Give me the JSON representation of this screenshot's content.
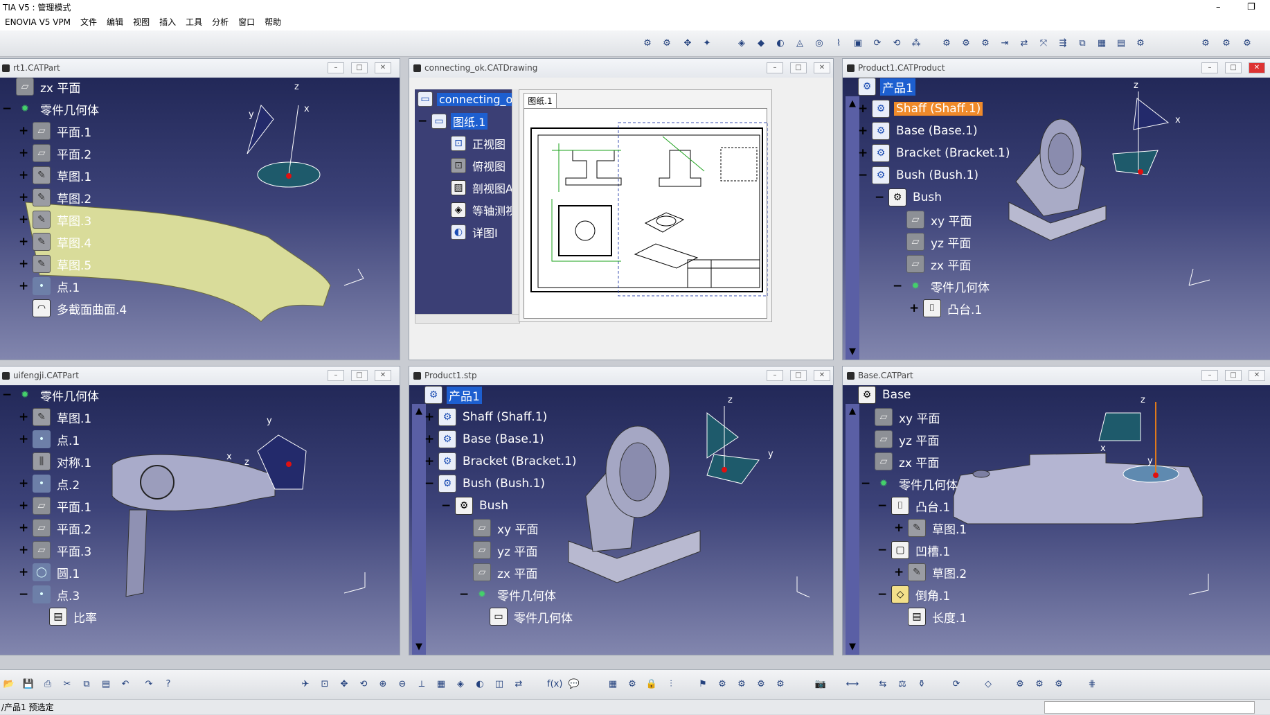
{
  "app": {
    "title": "TIA V5 : 管理模式",
    "status": "/产品1 预选定"
  },
  "menu": [
    "ENOVIA V5 VPM",
    "文件",
    "编辑",
    "视图",
    "插入",
    "工具",
    "分析",
    "窗口",
    "帮助"
  ],
  "windows": {
    "w1": {
      "title": "rt1.CATPart",
      "nodes": [
        "zx 平面",
        "零件几何体",
        "平面.1",
        "平面.2",
        "草图.1",
        "草图.2",
        "草图.3",
        "草图.4",
        "草图.5",
        "点.1",
        "多截面曲面.4"
      ]
    },
    "w2": {
      "title": "connecting_ok.CATDrawing",
      "tree": [
        "connecting_ok",
        "图纸.1",
        "正视图",
        "俯视图",
        "剖视图A",
        "等轴测视",
        "详图I"
      ],
      "tab": "图纸.1"
    },
    "w3": {
      "title": "Product1.CATProduct",
      "nodes": [
        "产品1",
        "Shaff (Shaff.1)",
        "Base (Base.1)",
        "Bracket (Bracket.1)",
        "Bush (Bush.1)",
        "Bush",
        "xy 平面",
        "yz 平面",
        "zx 平面",
        "零件几何体",
        "凸台.1"
      ]
    },
    "w4": {
      "title": "uifengji.CATPart",
      "nodes": [
        "零件几何体",
        "草图.1",
        "点.1",
        "对称.1",
        "点.2",
        "平面.1",
        "平面.2",
        "平面.3",
        "圆.1",
        "点.3",
        "比率"
      ]
    },
    "w5": {
      "title": "Product1.stp",
      "nodes": [
        "产品1",
        "Shaff (Shaff.1)",
        "Base (Base.1)",
        "Bracket (Bracket.1)",
        "Bush (Bush.1)",
        "Bush",
        "xy 平面",
        "yz 平面",
        "zx 平面",
        "零件几何体",
        "零件几何体"
      ]
    },
    "w6": {
      "title": "Base.CATPart",
      "nodes": [
        "Base",
        "xy 平面",
        "yz 平面",
        "zx 平面",
        "零件几何体",
        "凸台.1",
        "草图.1",
        "凹槽.1",
        "草图.2",
        "倒角.1",
        "长度.1"
      ]
    }
  },
  "axes": {
    "x": "x",
    "y": "y",
    "z": "z"
  },
  "colors": {
    "viewport_top": "#222858",
    "viewport_bottom": "#8286ae",
    "selection": "#1d5fd0",
    "highlight": "#f08a2a"
  }
}
